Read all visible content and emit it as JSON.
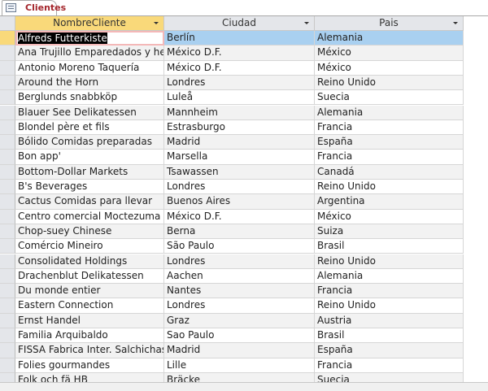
{
  "tab": {
    "label": "Clientes",
    "icon": "table-icon"
  },
  "columns": [
    "NombreCliente",
    "Ciudad",
    "Pais"
  ],
  "rows": [
    [
      "Alfreds Futterkiste",
      "Berlín",
      "Alemania"
    ],
    [
      "Ana Trujillo Emparedados y helados",
      "México D.F.",
      "México"
    ],
    [
      "Antonio Moreno Taquería",
      "México D.F.",
      "México"
    ],
    [
      "Around the Horn",
      "Londres",
      "Reino Unido"
    ],
    [
      "Berglunds snabbköp",
      "Luleå",
      "Suecia"
    ],
    [
      "Blauer See Delikatessen",
      "Mannheim",
      "Alemania"
    ],
    [
      "Blondel père et fils",
      "Estrasburgo",
      "Francia"
    ],
    [
      "Bólido Comidas preparadas",
      "Madrid",
      "España"
    ],
    [
      "Bon app'",
      "Marsella",
      "Francia"
    ],
    [
      "Bottom-Dollar Markets",
      "Tsawassen",
      "Canadá"
    ],
    [
      "B's Beverages",
      "Londres",
      "Reino Unido"
    ],
    [
      "Cactus Comidas para llevar",
      "Buenos Aires",
      "Argentina"
    ],
    [
      "Centro comercial Moctezuma",
      "México D.F.",
      "México"
    ],
    [
      "Chop-suey Chinese",
      "Berna",
      "Suiza"
    ],
    [
      "Comércio Mineiro",
      "São Paulo",
      "Brasil"
    ],
    [
      "Consolidated Holdings",
      "Londres",
      "Reino Unido"
    ],
    [
      "Drachenblut Delikatessen",
      "Aachen",
      "Alemania"
    ],
    [
      "Du monde entier",
      "Nantes",
      "Francia"
    ],
    [
      "Eastern Connection",
      "Londres",
      "Reino Unido"
    ],
    [
      "Ernst Handel",
      "Graz",
      "Austria"
    ],
    [
      "Familia Arquibaldo",
      "Sao Paulo",
      "Brasil"
    ],
    [
      "FISSA Fabrica Inter. Salchichas S.A.",
      "Madrid",
      "España"
    ],
    [
      "Folies gourmandes",
      "Lille",
      "Francia"
    ],
    [
      "Folk och fä HB",
      "Bräcke",
      "Suecia"
    ]
  ]
}
